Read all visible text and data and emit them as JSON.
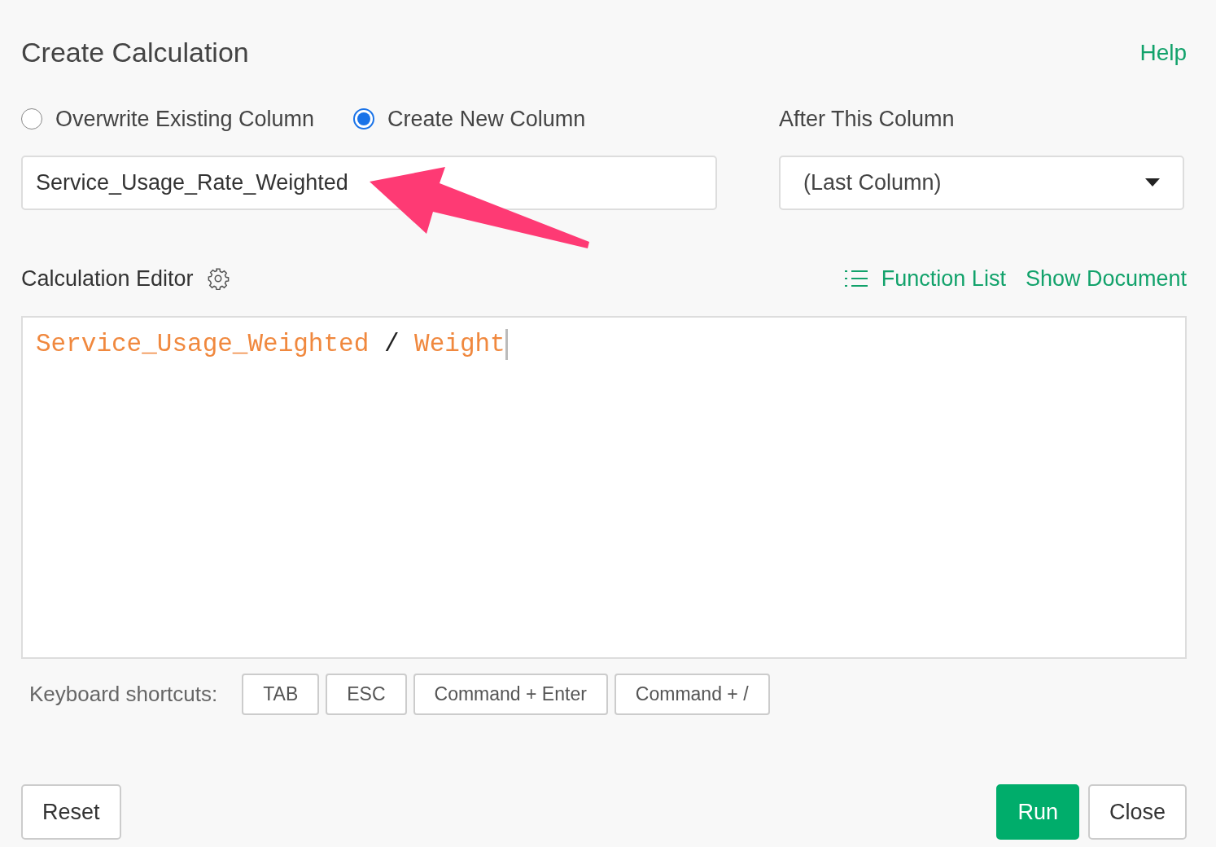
{
  "dialog": {
    "title": "Create Calculation",
    "help_link": "Help"
  },
  "mode_options": [
    {
      "label": "Overwrite Existing Column",
      "selected": false
    },
    {
      "label": "Create New Column",
      "selected": true
    }
  ],
  "new_column_name": {
    "value": "Service_Usage_Rate_Weighted"
  },
  "position": {
    "label": "After This Column",
    "value": "(Last Column)"
  },
  "editor": {
    "label": "Calculation Editor",
    "links": [
      "Function List",
      "Show Document"
    ],
    "tokens": [
      {
        "kind": "column",
        "text": "Service_Usage_Weighted"
      },
      {
        "kind": "operator",
        "text": "/"
      },
      {
        "kind": "column",
        "text": "Weight"
      }
    ]
  },
  "shortcuts": {
    "label": "Keyboard shortcuts:",
    "keys": [
      "TAB",
      "ESC",
      "Command + Enter",
      "Command + /"
    ]
  },
  "buttons": [
    {
      "label": "Reset",
      "kind": "secondary"
    },
    {
      "label": "Run",
      "kind": "primary"
    },
    {
      "label": "Close",
      "kind": "secondary"
    }
  ]
}
